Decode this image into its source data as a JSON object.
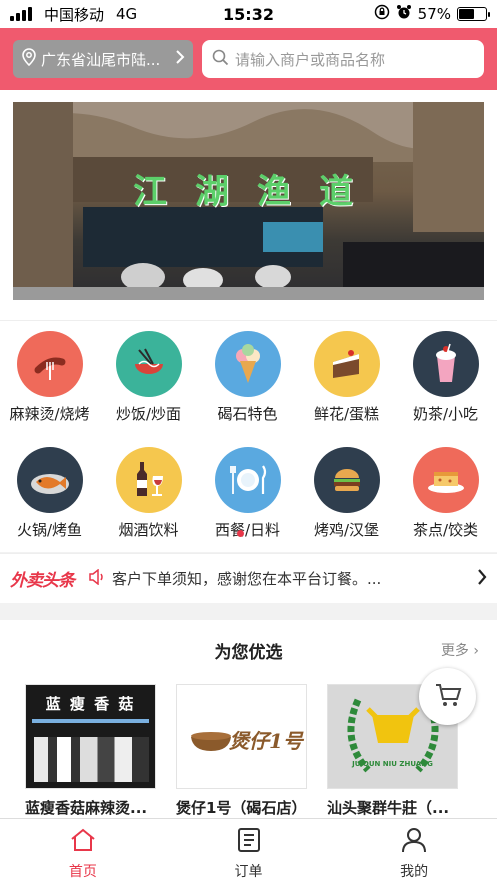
{
  "status_bar": {
    "carrier": "中国移动",
    "network": "4G",
    "time": "15:32",
    "battery": "57%",
    "battery_level": 0.57
  },
  "header": {
    "location": "广东省汕尾市陆...",
    "search_placeholder": "请输入商户或商品名称"
  },
  "banner": {
    "sign_text": "江湖渔道"
  },
  "categories": [
    {
      "label": "麻辣烫/烧烤",
      "icon": "skewer-icon",
      "color": "#ef6a5a"
    },
    {
      "label": "炒饭/炒面",
      "icon": "noodle-bowl-icon",
      "color": "#3bb39a"
    },
    {
      "label": "碣石特色",
      "icon": "ice-cream-icon",
      "color": "#5aa9e0"
    },
    {
      "label": "鲜花/蛋糕",
      "icon": "cake-icon",
      "color": "#f5c74e"
    },
    {
      "label": "奶茶/小吃",
      "icon": "milkshake-icon",
      "color": "#2f3e4e"
    },
    {
      "label": "火锅/烤鱼",
      "icon": "fish-icon",
      "color": "#2f3e4e"
    },
    {
      "label": "烟酒饮料",
      "icon": "wine-icon",
      "color": "#f5c74e"
    },
    {
      "label": "西餐/日料",
      "icon": "plate-icon",
      "color": "#5aa9e0"
    },
    {
      "label": "烤鸡/汉堡",
      "icon": "burger-icon",
      "color": "#2f3e4e"
    },
    {
      "label": "茶点/饺类",
      "icon": "dessert-icon",
      "color": "#ef6a5a"
    }
  ],
  "notice": {
    "logo": "外卖头条",
    "text": "客户下单须知，感谢您在本平台订餐。..."
  },
  "recommend": {
    "title": "为您优选",
    "more": "更多",
    "shops": [
      {
        "name": "蓝瘦香菇麻辣烫...",
        "img_text": "蓝 瘦 香 菇"
      },
      {
        "name": "煲仔1号（碣石店）",
        "img_text": "煲仔1号"
      },
      {
        "name": "汕头聚群牛莊（...",
        "img_text": "JU QUN NIU ZHUANG"
      }
    ]
  },
  "tabbar": {
    "items": [
      {
        "label": "首页"
      },
      {
        "label": "订单"
      },
      {
        "label": "我的"
      }
    ]
  },
  "colors": {
    "brand": "#f05a6e",
    "accent": "#e8374a"
  }
}
